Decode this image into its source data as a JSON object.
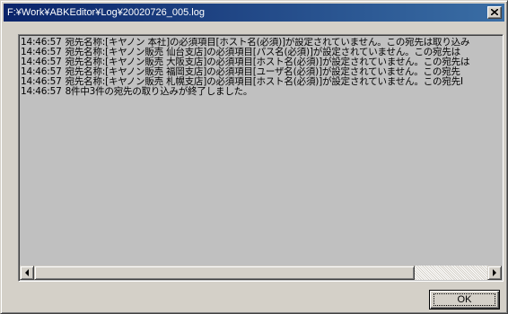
{
  "window": {
    "title": "F:¥Work¥ABKEditor¥Log¥20020726_005.log",
    "close_icon": "close-icon"
  },
  "log": {
    "lines": [
      {
        "time": "14:46:57",
        "text": "宛先名称:[キヤノン 本社]の必須項目[ホスト名(必須)]が設定されていません。この宛先は取り込み"
      },
      {
        "time": "14:46:57",
        "text": "宛先名称:[キヤノン販売 仙台支店]の必須項目[パス名(必須)]が設定されていません。この宛先は"
      },
      {
        "time": "14:46:57",
        "text": "宛先名称:[キヤノン販売 大阪支店]の必須項目[ホスト名(必須)]が設定されていません。この宛先は"
      },
      {
        "time": "14:46:57",
        "text": "宛先名称:[キヤノン販売 福岡支店]の必須項目[ユーザ名(必須)]が設定されていません。この宛先"
      },
      {
        "time": "14:46:57",
        "text": "宛先名称:[キヤノン販売 札幌支店]の必須項目[ホスト名(必須)]が設定されていません。この宛先I"
      },
      {
        "time": "14:46:57",
        "text": "8件中3件の宛先の取り込みが終了しました。"
      }
    ]
  },
  "scrollbar": {
    "left_icon": "arrow-left-icon",
    "right_icon": "arrow-right-icon"
  },
  "buttons": {
    "ok_label": "OK"
  }
}
